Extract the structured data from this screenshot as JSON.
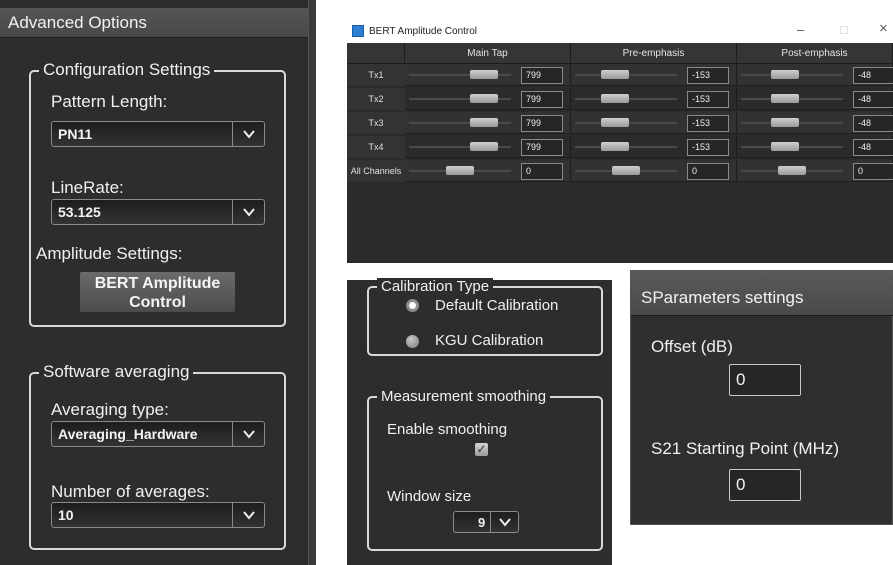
{
  "advanced": {
    "title": "Advanced Options",
    "configuration": {
      "legend": "Configuration Settings",
      "pattern_length_label": "Pattern Length:",
      "pattern_length_value": "PN11",
      "line_rate_label": "LineRate:",
      "line_rate_value": "53.125",
      "amplitude_label": "Amplitude Settings:",
      "bert_button": "BERT Amplitude\nControl"
    },
    "software_averaging": {
      "legend": "Software averaging",
      "averaging_type_label": "Averaging type:",
      "averaging_type_value": "Averaging_Hardware",
      "number_label": "Number of averages:",
      "number_value": "10"
    }
  },
  "bert": {
    "window_title": "BERT Amplitude Control",
    "controls": {
      "minimize": "–",
      "maximize": "□",
      "close": "×"
    },
    "headers": [
      "Main Tap",
      "Pre-emphasis",
      "Post-emphasis"
    ],
    "rows": [
      {
        "label": "Tx1",
        "main": "799",
        "pre": "-153",
        "post": "-48",
        "main_level": 0.82,
        "pre_level": 0.35,
        "post_level": 0.4
      },
      {
        "label": "Tx2",
        "main": "799",
        "pre": "-153",
        "post": "-48",
        "main_level": 0.82,
        "pre_level": 0.35,
        "post_level": 0.4
      },
      {
        "label": "Tx3",
        "main": "799",
        "pre": "-153",
        "post": "-48",
        "main_level": 0.82,
        "pre_level": 0.35,
        "post_level": 0.4
      },
      {
        "label": "Tx4",
        "main": "799",
        "pre": "-153",
        "post": "-48",
        "main_level": 0.82,
        "pre_level": 0.35,
        "post_level": 0.4
      },
      {
        "label": "All Channels",
        "main": "0",
        "pre": "0",
        "post": "0",
        "main_level": 0.5,
        "pre_level": 0.5,
        "post_level": 0.5
      }
    ]
  },
  "calibration": {
    "legend": "Calibration Type",
    "default": "Default Calibration",
    "kgu": "KGU Calibration",
    "selected": "Default Calibration"
  },
  "smoothing": {
    "legend": "Measurement smoothing",
    "enable_label": "Enable smoothing",
    "enable_checked": "✓",
    "window_label": "Window size",
    "window_value": "9"
  },
  "sparams": {
    "title": "SParameters settings",
    "offset_label": "Offset (dB)",
    "offset_value": "0",
    "s21_label": "S21 Starting Point (MHz)",
    "s21_value": "0"
  }
}
